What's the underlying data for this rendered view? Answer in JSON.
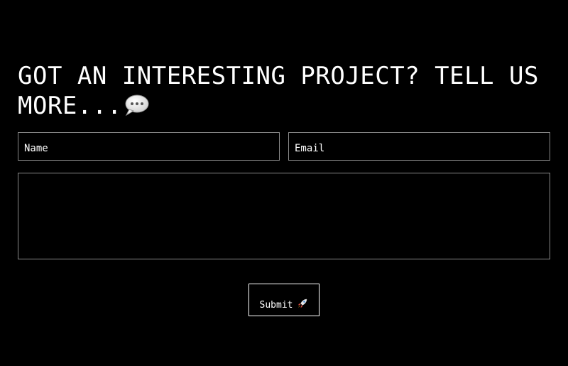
{
  "heading": {
    "text": "GOT AN INTERESTING PROJECT? TELL US MORE...",
    "icon": "speech-bubble-icon"
  },
  "form": {
    "name_placeholder": "Name",
    "email_placeholder": "Email",
    "message_placeholder": "",
    "submit_label": "Submit",
    "submit_icon": "rocket-icon"
  },
  "colors": {
    "background": "#000000",
    "text": "#ffffff",
    "field_border": "#8a8a8a",
    "button_border": "#ffffff"
  }
}
